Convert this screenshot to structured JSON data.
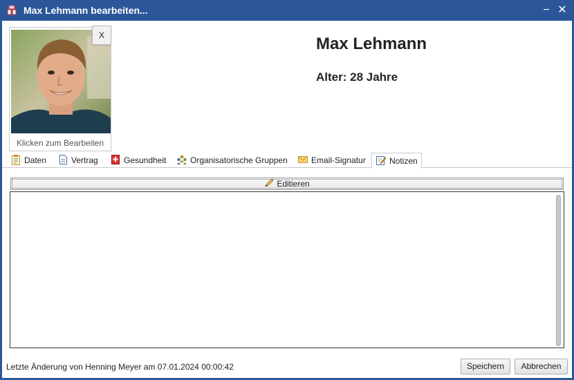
{
  "window": {
    "title": "Max Lehmann bearbeiten...",
    "minimize": "−",
    "close": "✕"
  },
  "profile": {
    "photo_caption": "Klicken zum Bearbeiten",
    "photo_remove": "X",
    "name": "Max Lehmann",
    "age": "Alter: 28 Jahre"
  },
  "tabs": [
    {
      "label": "Daten",
      "icon": "clipboard-icon"
    },
    {
      "label": "Vertrag",
      "icon": "contract-icon"
    },
    {
      "label": "Gesundheit",
      "icon": "health-plus-icon"
    },
    {
      "label": "Organisatorische Gruppen",
      "icon": "group-icon"
    },
    {
      "label": "Email-Signatur",
      "icon": "envelope-icon"
    },
    {
      "label": "Notizen",
      "icon": "notes-edit-icon",
      "active": true
    }
  ],
  "notes": {
    "edit_label": "Editieren",
    "content": ""
  },
  "footer": {
    "status": "Letzte Änderung von Henning Meyer am 07.01.2024 00:00:42",
    "save_label": "Speichern",
    "cancel_label": "Abbrechen"
  },
  "colors": {
    "titlebar": "#2b579a",
    "background": "#ffffff"
  }
}
